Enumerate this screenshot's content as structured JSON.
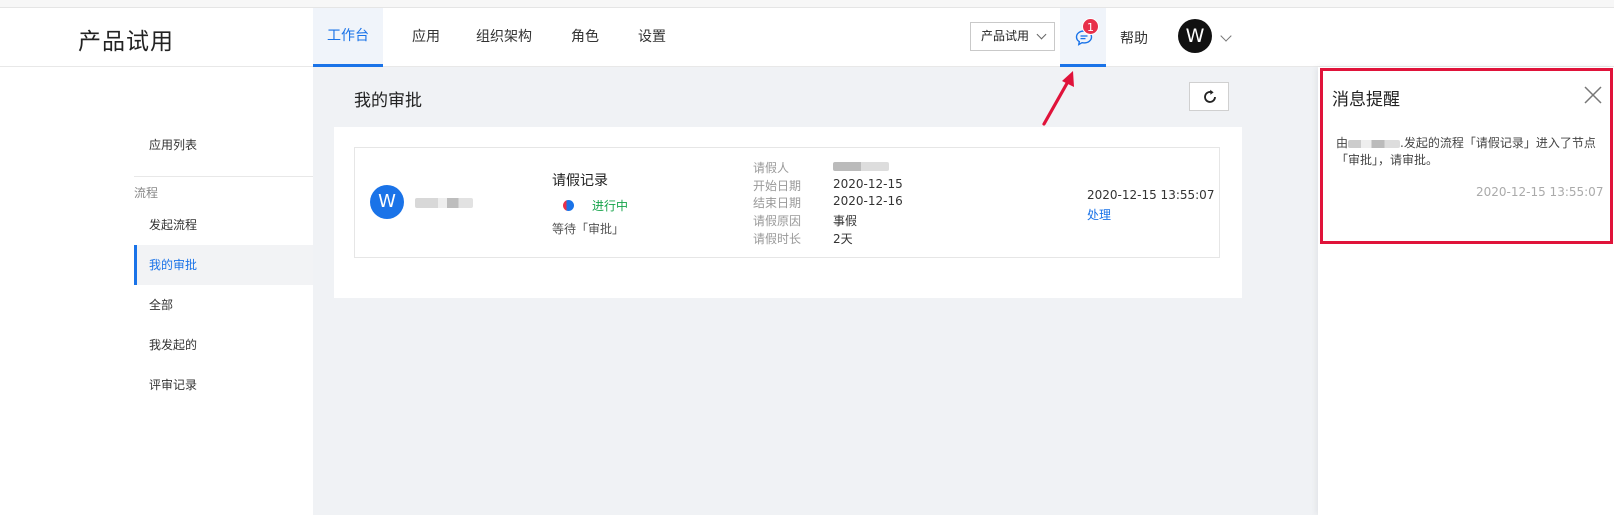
{
  "header": {
    "app_title": "产品试用",
    "tabs": [
      {
        "label": "工作台",
        "active": true
      },
      {
        "label": "应用"
      },
      {
        "label": "组织架构"
      },
      {
        "label": "角色"
      },
      {
        "label": "设置"
      }
    ],
    "product_select": "产品试用",
    "message_badge": "1",
    "help_label": "帮助",
    "avatar_letter": "W"
  },
  "sidebar": {
    "app_list": "应用列表",
    "group_label": "流程",
    "items": [
      {
        "label": "发起流程"
      },
      {
        "label": "我的审批",
        "active": true
      },
      {
        "label": "全部"
      },
      {
        "label": "我发起的"
      },
      {
        "label": "评审记录"
      }
    ]
  },
  "main": {
    "page_title": "我的审批",
    "card": {
      "avatar_letter": "W",
      "title": "请假记录",
      "status": "进行中",
      "waiting": "等待「审批」",
      "fields": [
        {
          "label": "请假人",
          "value": ""
        },
        {
          "label": "开始日期",
          "value": "2020-12-15"
        },
        {
          "label": "结束日期",
          "value": "2020-12-16"
        },
        {
          "label": "请假原因",
          "value": "事假"
        },
        {
          "label": "请假时长",
          "value": "2天"
        }
      ],
      "time": "2020-12-15 13:55:07",
      "action": "处理"
    }
  },
  "notify": {
    "title": "消息提醒",
    "text_prefix": "由",
    "text_suffix": ".发起的流程「请假记录」进入了节点「审批」，请审批。",
    "time": "2020-12-15 13:55:07"
  },
  "colors": {
    "accent": "#1a73e8",
    "badge": "#e8304a",
    "status_green": "#15a34a",
    "highlight_red": "#e0133a"
  }
}
